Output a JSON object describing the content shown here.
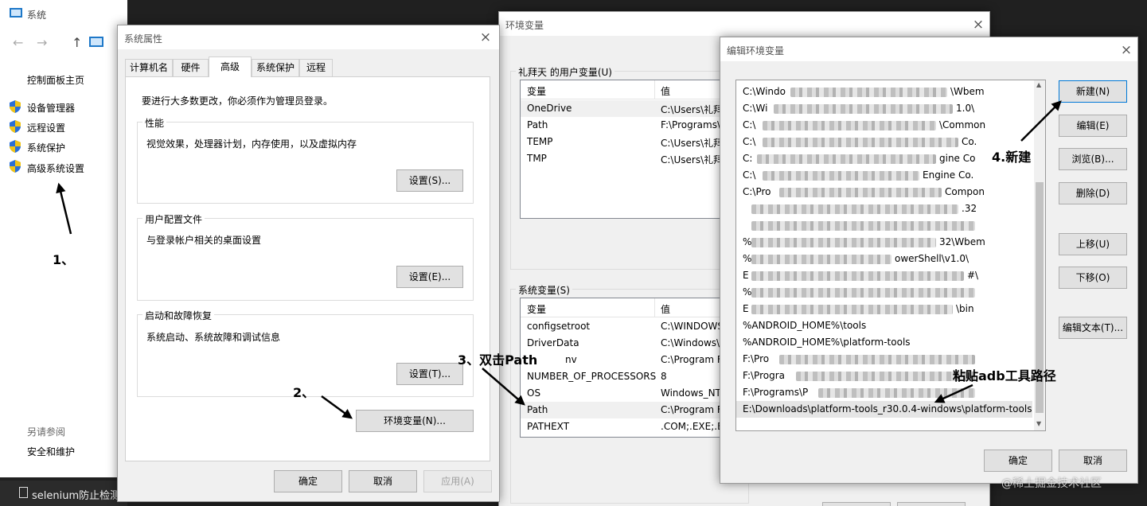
{
  "system_window": {
    "title": "系统",
    "sidebar_title": "控制面板主页",
    "items": [
      {
        "label": "设备管理器"
      },
      {
        "label": "远程设置"
      },
      {
        "label": "系统保护"
      },
      {
        "label": "高级系统设置"
      }
    ],
    "see_also_title": "另请参阅",
    "see_also_item": "安全和维护"
  },
  "taskbar": {
    "item_label": "selenium防止检测"
  },
  "props_dialog": {
    "title": "系统属性",
    "tabs": [
      {
        "label": "计算机名"
      },
      {
        "label": "硬件"
      },
      {
        "label": "高级"
      },
      {
        "label": "系统保护"
      },
      {
        "label": "远程"
      }
    ],
    "admin_note": "要进行大多数更改，你必须作为管理员登录。",
    "perf_title": "性能",
    "perf_desc": "视觉效果，处理器计划，内存使用，以及虚拟内存",
    "perf_btn": "设置(S)...",
    "profile_title": "用户配置文件",
    "profile_desc": "与登录帐户相关的桌面设置",
    "profile_btn": "设置(E)...",
    "startup_title": "启动和故障恢复",
    "startup_desc": "系统启动、系统故障和调试信息",
    "startup_btn": "设置(T)...",
    "env_btn": "环境变量(N)...",
    "ok": "确定",
    "cancel": "取消",
    "apply": "应用(A)"
  },
  "env_dialog": {
    "title": "环境变量",
    "user_group_title": "礼拜天 的用户变量(U)",
    "col_var": "变量",
    "col_val": "值",
    "user_vars": [
      {
        "name": "OneDrive",
        "value": "C:\\Users\\礼拜"
      },
      {
        "name": "Path",
        "value": "F:\\Programs\\"
      },
      {
        "name": "TEMP",
        "value": "C:\\Users\\礼拜"
      },
      {
        "name": "TMP",
        "value": "C:\\Users\\礼拜"
      }
    ],
    "sys_group_title": "系统变量(S)",
    "sys_vars": [
      {
        "name": "configsetroot",
        "value": "C:\\WINDOWS"
      },
      {
        "name": "DriverData",
        "value": "C:\\Windows\\S"
      },
      {
        "name": "nv",
        "value": "C:\\Program F"
      },
      {
        "name": "NUMBER_OF_PROCESSORS",
        "value": "8"
      },
      {
        "name": "OS",
        "value": "Windows_NT"
      },
      {
        "name": "Path",
        "value": "C:\\Program F"
      },
      {
        "name": "PATHEXT",
        "value": ".COM;.EXE;.B"
      }
    ]
  },
  "edit_dialog": {
    "title": "编辑环境变量",
    "entries": [
      "C:\\Windo",
      "C:\\Wi",
      "C:\\",
      "C:\\",
      "C:",
      "C:\\",
      "C:\\Pro",
      "",
      "",
      "%",
      "%",
      "E",
      "%",
      "E",
      "%ANDROID_HOME%\\tools",
      "%ANDROID_HOME%\\platform-tools",
      "F:\\Pro",
      "F:\\Progra",
      "F:\\Programs\\P",
      "E:\\Downloads\\platform-tools_r30.0.4-windows\\platform-tools"
    ],
    "entry_tails": [
      "\\Wbem",
      "1.0\\",
      "\\Common",
      "Co.",
      "gine Co",
      "Engine Co.",
      "Compon",
      ".32",
      "",
      "32\\Wbem",
      "owerShell\\v1.0\\",
      "#\\",
      "",
      "\\bin",
      "",
      "",
      "",
      "",
      "",
      ""
    ],
    "buttons": {
      "new": "新建(N)",
      "edit": "编辑(E)",
      "browse": "浏览(B)...",
      "delete": "删除(D)",
      "up": "上移(U)",
      "down": "下移(O)",
      "edit_text": "编辑文本(T)..."
    },
    "ok": "确定",
    "cancel": "取消"
  },
  "annotations": {
    "step1": "1、",
    "step2": "2、",
    "step3": "3、双击Path",
    "step4": "4.新建",
    "paste_note": "粘贴adb工具路径"
  },
  "watermark": "@稀土掘金技术社区"
}
